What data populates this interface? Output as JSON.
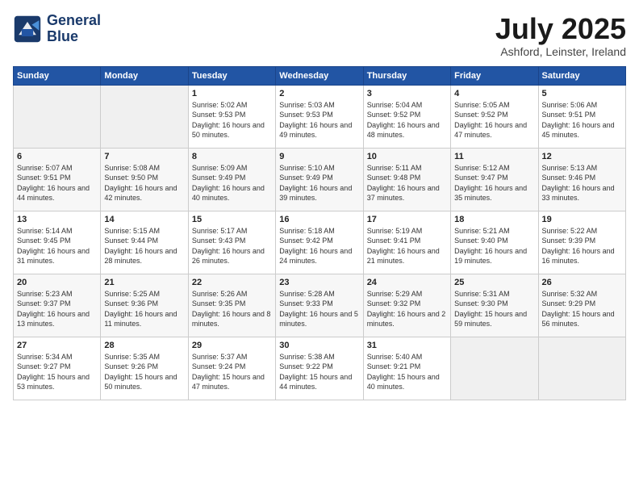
{
  "header": {
    "logo_line1": "General",
    "logo_line2": "Blue",
    "month_title": "July 2025",
    "location": "Ashford, Leinster, Ireland"
  },
  "weekdays": [
    "Sunday",
    "Monday",
    "Tuesday",
    "Wednesday",
    "Thursday",
    "Friday",
    "Saturday"
  ],
  "weeks": [
    [
      {
        "day": "",
        "content": ""
      },
      {
        "day": "",
        "content": ""
      },
      {
        "day": "1",
        "content": "Sunrise: 5:02 AM\nSunset: 9:53 PM\nDaylight: 16 hours\nand 50 minutes."
      },
      {
        "day": "2",
        "content": "Sunrise: 5:03 AM\nSunset: 9:53 PM\nDaylight: 16 hours\nand 49 minutes."
      },
      {
        "day": "3",
        "content": "Sunrise: 5:04 AM\nSunset: 9:52 PM\nDaylight: 16 hours\nand 48 minutes."
      },
      {
        "day": "4",
        "content": "Sunrise: 5:05 AM\nSunset: 9:52 PM\nDaylight: 16 hours\nand 47 minutes."
      },
      {
        "day": "5",
        "content": "Sunrise: 5:06 AM\nSunset: 9:51 PM\nDaylight: 16 hours\nand 45 minutes."
      }
    ],
    [
      {
        "day": "6",
        "content": "Sunrise: 5:07 AM\nSunset: 9:51 PM\nDaylight: 16 hours\nand 44 minutes."
      },
      {
        "day": "7",
        "content": "Sunrise: 5:08 AM\nSunset: 9:50 PM\nDaylight: 16 hours\nand 42 minutes."
      },
      {
        "day": "8",
        "content": "Sunrise: 5:09 AM\nSunset: 9:49 PM\nDaylight: 16 hours\nand 40 minutes."
      },
      {
        "day": "9",
        "content": "Sunrise: 5:10 AM\nSunset: 9:49 PM\nDaylight: 16 hours\nand 39 minutes."
      },
      {
        "day": "10",
        "content": "Sunrise: 5:11 AM\nSunset: 9:48 PM\nDaylight: 16 hours\nand 37 minutes."
      },
      {
        "day": "11",
        "content": "Sunrise: 5:12 AM\nSunset: 9:47 PM\nDaylight: 16 hours\nand 35 minutes."
      },
      {
        "day": "12",
        "content": "Sunrise: 5:13 AM\nSunset: 9:46 PM\nDaylight: 16 hours\nand 33 minutes."
      }
    ],
    [
      {
        "day": "13",
        "content": "Sunrise: 5:14 AM\nSunset: 9:45 PM\nDaylight: 16 hours\nand 31 minutes."
      },
      {
        "day": "14",
        "content": "Sunrise: 5:15 AM\nSunset: 9:44 PM\nDaylight: 16 hours\nand 28 minutes."
      },
      {
        "day": "15",
        "content": "Sunrise: 5:17 AM\nSunset: 9:43 PM\nDaylight: 16 hours\nand 26 minutes."
      },
      {
        "day": "16",
        "content": "Sunrise: 5:18 AM\nSunset: 9:42 PM\nDaylight: 16 hours\nand 24 minutes."
      },
      {
        "day": "17",
        "content": "Sunrise: 5:19 AM\nSunset: 9:41 PM\nDaylight: 16 hours\nand 21 minutes."
      },
      {
        "day": "18",
        "content": "Sunrise: 5:21 AM\nSunset: 9:40 PM\nDaylight: 16 hours\nand 19 minutes."
      },
      {
        "day": "19",
        "content": "Sunrise: 5:22 AM\nSunset: 9:39 PM\nDaylight: 16 hours\nand 16 minutes."
      }
    ],
    [
      {
        "day": "20",
        "content": "Sunrise: 5:23 AM\nSunset: 9:37 PM\nDaylight: 16 hours\nand 13 minutes."
      },
      {
        "day": "21",
        "content": "Sunrise: 5:25 AM\nSunset: 9:36 PM\nDaylight: 16 hours\nand 11 minutes."
      },
      {
        "day": "22",
        "content": "Sunrise: 5:26 AM\nSunset: 9:35 PM\nDaylight: 16 hours\nand 8 minutes."
      },
      {
        "day": "23",
        "content": "Sunrise: 5:28 AM\nSunset: 9:33 PM\nDaylight: 16 hours\nand 5 minutes."
      },
      {
        "day": "24",
        "content": "Sunrise: 5:29 AM\nSunset: 9:32 PM\nDaylight: 16 hours\nand 2 minutes."
      },
      {
        "day": "25",
        "content": "Sunrise: 5:31 AM\nSunset: 9:30 PM\nDaylight: 15 hours\nand 59 minutes."
      },
      {
        "day": "26",
        "content": "Sunrise: 5:32 AM\nSunset: 9:29 PM\nDaylight: 15 hours\nand 56 minutes."
      }
    ],
    [
      {
        "day": "27",
        "content": "Sunrise: 5:34 AM\nSunset: 9:27 PM\nDaylight: 15 hours\nand 53 minutes."
      },
      {
        "day": "28",
        "content": "Sunrise: 5:35 AM\nSunset: 9:26 PM\nDaylight: 15 hours\nand 50 minutes."
      },
      {
        "day": "29",
        "content": "Sunrise: 5:37 AM\nSunset: 9:24 PM\nDaylight: 15 hours\nand 47 minutes."
      },
      {
        "day": "30",
        "content": "Sunrise: 5:38 AM\nSunset: 9:22 PM\nDaylight: 15 hours\nand 44 minutes."
      },
      {
        "day": "31",
        "content": "Sunrise: 5:40 AM\nSunset: 9:21 PM\nDaylight: 15 hours\nand 40 minutes."
      },
      {
        "day": "",
        "content": ""
      },
      {
        "day": "",
        "content": ""
      }
    ]
  ]
}
